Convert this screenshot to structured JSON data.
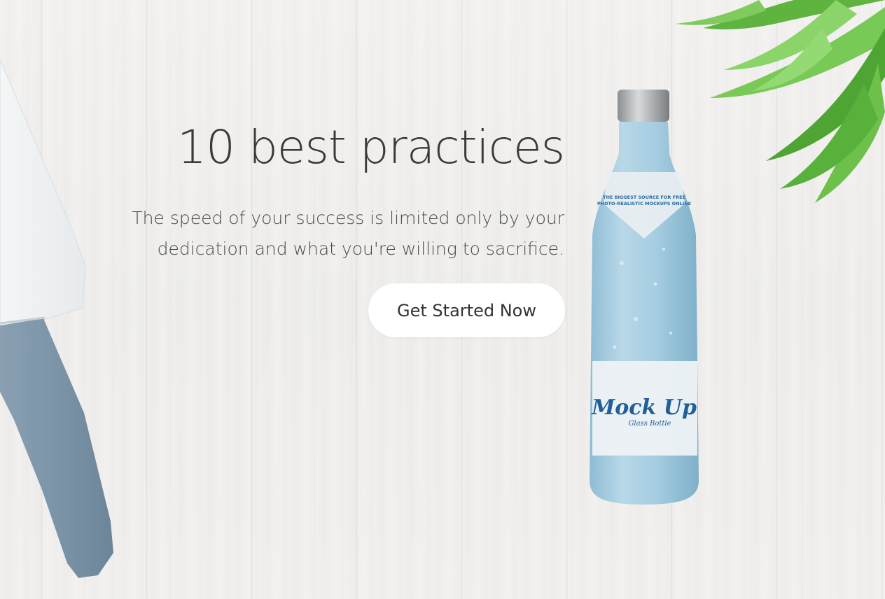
{
  "hero": {
    "headline": "10 best practices",
    "subline": "The speed of your success is limited only by your dedication and what you're willing to sacrifice.",
    "cta_label": "Get Started Now"
  },
  "bottle_label": {
    "top_line_1": "THE BIGGEST SOURCE FOR FREE",
    "top_line_2": "PHOTO-REALISTIC MOCKUPS ONLINE",
    "brand": "Mock Up",
    "sub": "Glass Bottle"
  },
  "colors": {
    "background": "#efedeb",
    "text": "#3a3a3a",
    "button_bg": "#ffffff",
    "bottle_glass": "#a9cde0",
    "leaf": "#6cc24a",
    "knife_handle": "#7f97ab"
  }
}
